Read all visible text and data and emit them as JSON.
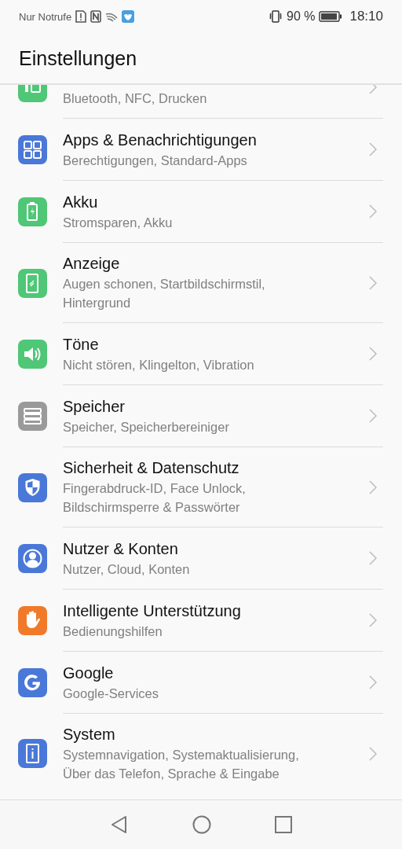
{
  "status_bar": {
    "carrier": "Nur Notrufe",
    "battery_text": "90 %",
    "time": "18:10"
  },
  "header": {
    "title": "Einstellungen"
  },
  "items": [
    {
      "subtitle": "Bluetooth, NFC, Drucken"
    },
    {
      "title": "Apps & Benachrichtigungen",
      "subtitle": "Berechtigungen, Standard-Apps"
    },
    {
      "title": "Akku",
      "subtitle": "Stromsparen, Akku"
    },
    {
      "title": "Anzeige",
      "subtitle": "Augen schonen, Startbildschirmstil, Hintergrund"
    },
    {
      "title": "Töne",
      "subtitle": "Nicht stören, Klingelton, Vibration"
    },
    {
      "title": "Speicher",
      "subtitle": "Speicher, Speicherbereiniger"
    },
    {
      "title": "Sicherheit & Datenschutz",
      "subtitle": "Fingerabdruck-ID, Face Unlock, Bildschirmsperre & Passwörter"
    },
    {
      "title": "Nutzer & Konten",
      "subtitle": "Nutzer, Cloud, Konten"
    },
    {
      "title": "Intelligente Unterstützung",
      "subtitle": "Bedienungshilfen"
    },
    {
      "title": "Google",
      "subtitle": "Google-Services"
    },
    {
      "title": "System",
      "subtitle": "Systemnavigation, Systemaktualisierung, Über das Telefon, Sprache & Eingabe"
    }
  ]
}
